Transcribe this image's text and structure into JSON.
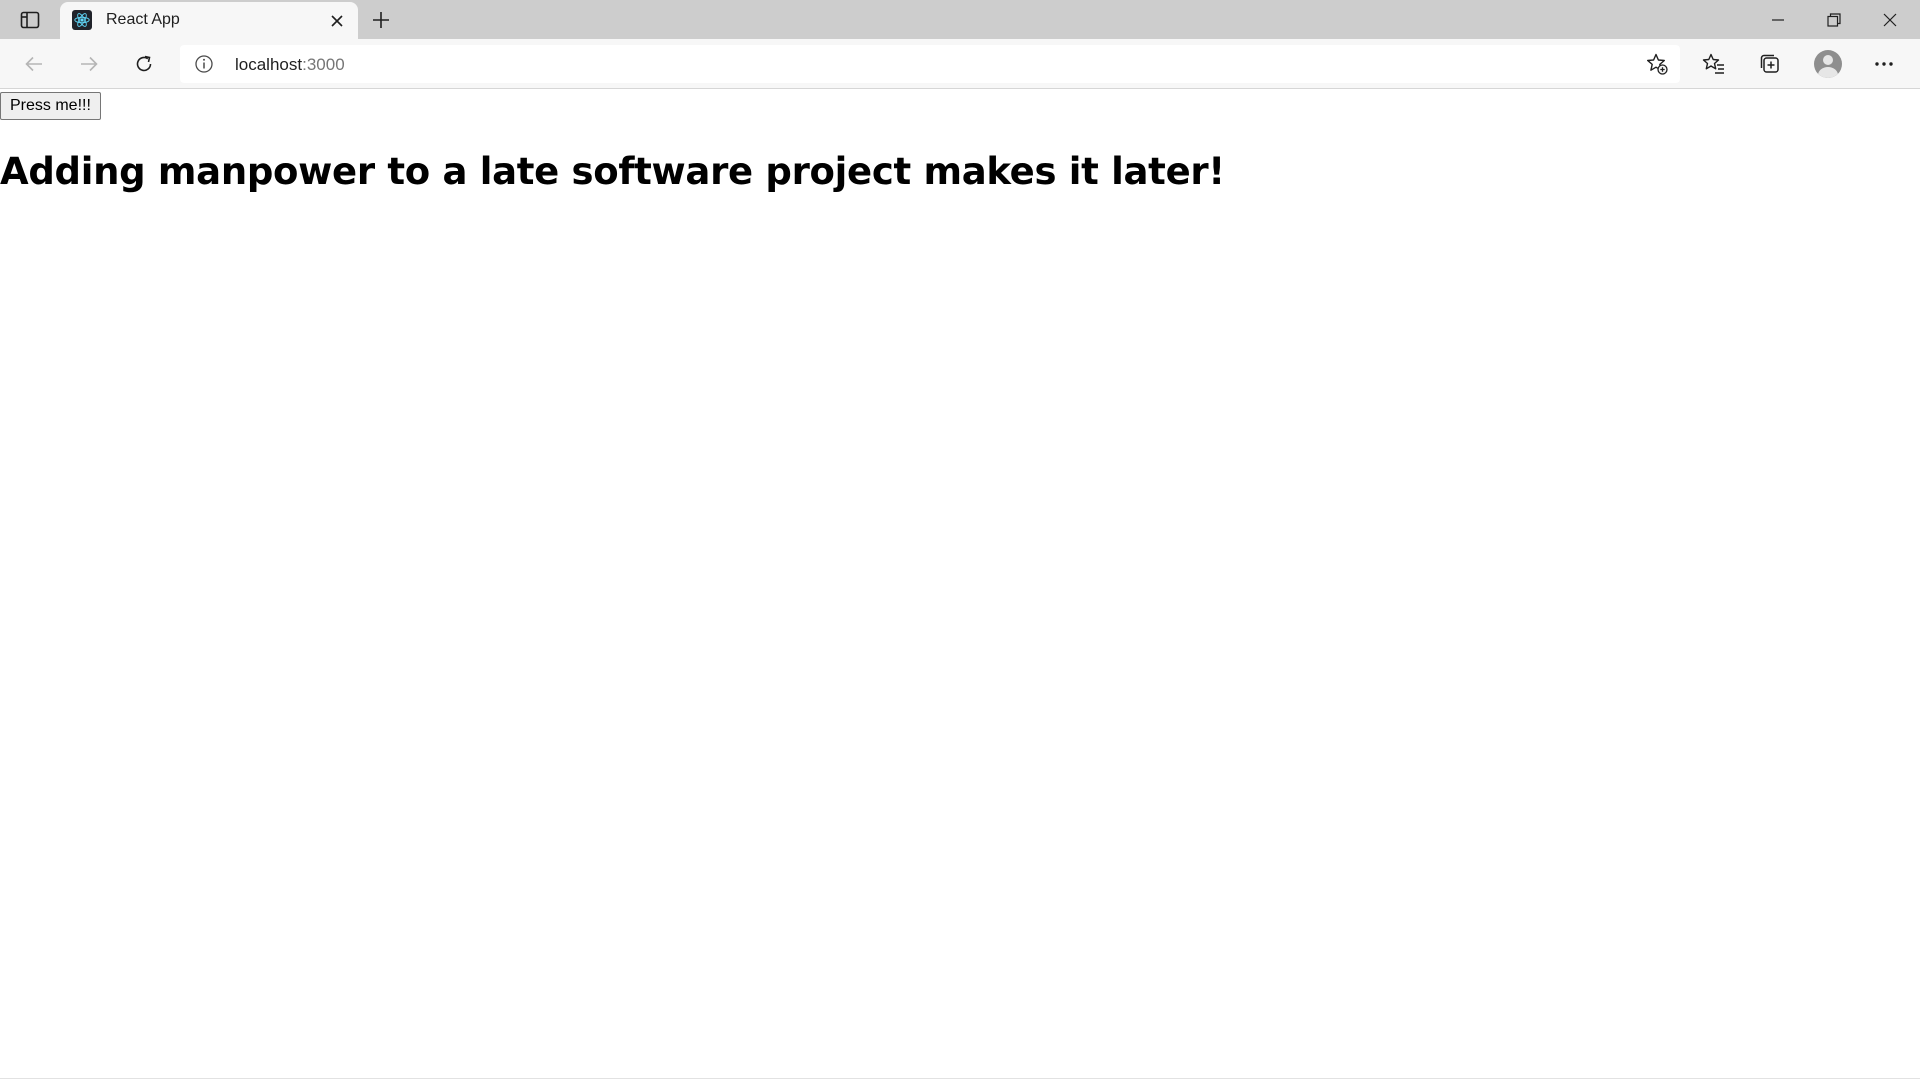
{
  "browser": {
    "tab": {
      "title": "React App",
      "favicon": "react-logo-icon"
    },
    "address_bar": {
      "host": "localhost",
      "port": ":3000"
    },
    "colors": {
      "tabstrip": "#cdcdcd",
      "toolbar": "#f7f7f7"
    }
  },
  "page": {
    "button_label": "Press me!!!",
    "headline": "Adding manpower to a late software project makes it later!"
  }
}
